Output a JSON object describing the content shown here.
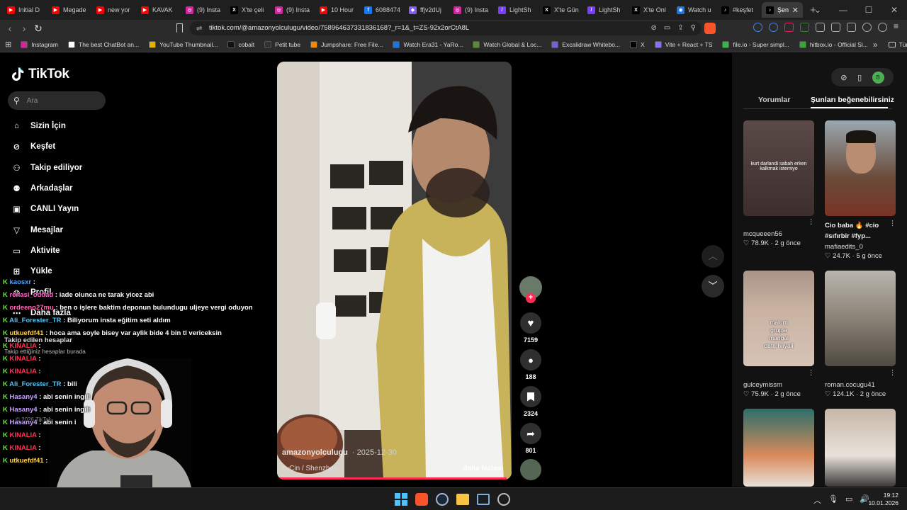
{
  "tabs": [
    {
      "label": "Initial D",
      "color": "#ff0000",
      "glyph": "▶"
    },
    {
      "label": "Megade",
      "color": "#ff0000",
      "glyph": "▶"
    },
    {
      "label": "new yor",
      "color": "#ff0000",
      "glyph": "▶"
    },
    {
      "label": "KAVAK",
      "color": "#ff0000",
      "glyph": "▶"
    },
    {
      "label": "(9) Insta",
      "color": "#d6249f",
      "glyph": "◎"
    },
    {
      "label": "X'te çeli",
      "color": "#000000",
      "glyph": "X"
    },
    {
      "label": "(9) Insta",
      "color": "#d6249f",
      "glyph": "◎"
    },
    {
      "label": "10 Hour",
      "color": "#ff0000",
      "glyph": "▶"
    },
    {
      "label": "6088474",
      "color": "#1877f2",
      "glyph": "f"
    },
    {
      "label": "ffjv2dUj",
      "color": "#8a5cf6",
      "glyph": "◆"
    },
    {
      "label": "(9) Insta",
      "color": "#d6249f",
      "glyph": "◎"
    },
    {
      "label": "LightSh",
      "color": "#7a3cff",
      "glyph": "/"
    },
    {
      "label": "X'te Gün",
      "color": "#000000",
      "glyph": "X"
    },
    {
      "label": "LightSh",
      "color": "#7a3cff",
      "glyph": "/"
    },
    {
      "label": "X'te Onl",
      "color": "#000000",
      "glyph": "X"
    },
    {
      "label": "Watch u",
      "color": "#1a73e8",
      "glyph": "◉"
    },
    {
      "label": "#keşfet",
      "color": "#000000",
      "glyph": "♪"
    },
    {
      "label": "Şen",
      "color": "#000000",
      "glyph": "♪",
      "active": true
    }
  ],
  "address": {
    "url": "tiktok.com/@amazonyolculugu/video/7589646373318361​68?_r=1&_t=ZS-92x2orCtA8L"
  },
  "bookmarks": [
    {
      "label": "Instagram",
      "color": "#d6249f"
    },
    {
      "label": "The best ChatBot an...",
      "color": "#ffffff"
    },
    {
      "label": "YouTube Thumbnail...",
      "color": "#e6b400"
    },
    {
      "label": "cobalt",
      "color": "#111111"
    },
    {
      "label": "Petit tube",
      "color": "#333333"
    },
    {
      "label": "Jumpshare: Free File...",
      "color": "#f28b00"
    },
    {
      "label": "Watch Era31 - YaRo...",
      "color": "#1a73e8"
    },
    {
      "label": "Watch Global & Loc...",
      "color": "#5b8c2a"
    },
    {
      "label": "Excalidraw Whitebo...",
      "color": "#6965db"
    },
    {
      "label": "X",
      "color": "#000000"
    },
    {
      "label": "Vite + React + TS",
      "color": "#8e6cff"
    },
    {
      "label": "file.io - Super simpl...",
      "color": "#3bb54a"
    },
    {
      "label": "hitbox.io - Official Si...",
      "color": "#33aa33"
    }
  ],
  "bookmarks_all": "Tüm Yer İşaretleri",
  "brand": "TikTok",
  "search_placeholder": "Ara",
  "nav": [
    "Sizin İçin",
    "Keşfet",
    "Takip ediliyor",
    "Arkadaşlar",
    "CANLI Yayın",
    "Mesajlar",
    "Aktivite",
    "Yükle",
    "Profil",
    "Daha fazla"
  ],
  "following": {
    "title": "Takip edilen hesaplar",
    "subtitle": "Takip ettiğiniz hesaplar burada"
  },
  "footer": "© 2026 TikTok",
  "video": {
    "author": "amazonyolculugu",
    "date": "· 2025-12-30",
    "location": "Çin / Shenzhen",
    "more": "daha fazlası",
    "progress_pct": 0.98
  },
  "actions": {
    "likes": "7159",
    "comments": "188",
    "saves": "2324",
    "shares": "801"
  },
  "right_tabs": [
    "Yorumlar",
    "Şunları beğenebilirsiniz"
  ],
  "suggestions": [
    {
      "overlay": "kurt darlandi sabah erken\nkalkmak istemiyo",
      "title": "",
      "author": "mcqueeen56",
      "likes": "78.9K",
      "age": "2 g önce"
    },
    {
      "overlay": "",
      "title": "Cio baba 🔥 #cio #sıfırbir #fyp...",
      "author": "mafiaedits_0",
      "likes": "24.7K",
      "age": "5 g önce"
    },
    {
      "overlay": "malum\ngrupla\nmangal\ndate hayali",
      "title": "",
      "author": "gulceymissm",
      "likes": "75.9K",
      "age": "2 g önce"
    },
    {
      "overlay": "",
      "title": "",
      "author": "roman.cocugu41",
      "likes": "124.1K",
      "age": "2 g önce"
    }
  ],
  "chat": [
    {
      "user": "kaosxr",
      "msg": ":",
      "color": "#4ea3ff"
    },
    {
      "user": "renasi_oddad",
      "msg": ": iade olunca ne tarak yicez abi",
      "color": "#ff66cc"
    },
    {
      "user": "ordeeno27mu",
      "msg": ": ben o işlere baktim deponun bulundugu uljeye vergi oduyon",
      "color": "#ff69b4"
    },
    {
      "user": "Ali_Forester_TR",
      "msg": ": Biliyorum insta eğitim seti aldım",
      "color": "#4fc3f7"
    },
    {
      "user": "utkuefdf41",
      "msg": ": hoca ama soyle bisey var aylik bide 4 bin tl vericeksin",
      "color": "#ffd54f"
    },
    {
      "user": "KINALIA",
      "msg": ":",
      "color": "#ff3355"
    },
    {
      "user": "KINALIA",
      "msg": ":",
      "color": "#ff3355"
    },
    {
      "user": "KINALIA",
      "msg": ":",
      "color": "#ff3355"
    },
    {
      "user": "Ali_Forester_TR",
      "msg": ": bili",
      "color": "#4fc3f7"
    },
    {
      "user": "Hasany4",
      "msg": ": abi senin ingili",
      "color": "#c8a2ff"
    },
    {
      "user": "Hasany4",
      "msg": ": abi senin ingili",
      "color": "#c8a2ff"
    },
    {
      "user": "Hasany4",
      "msg": ": abi senin i",
      "color": "#c8a2ff"
    },
    {
      "user": "KINALIA",
      "msg": ":",
      "color": "#ff3355"
    },
    {
      "user": "KINALIA",
      "msg": ":",
      "color": "#ff3355"
    },
    {
      "user": "utkuefdf41",
      "msg": ":",
      "color": "#ffd54f"
    }
  ],
  "clock": {
    "time": "19:12",
    "date": "10.01.2026"
  }
}
